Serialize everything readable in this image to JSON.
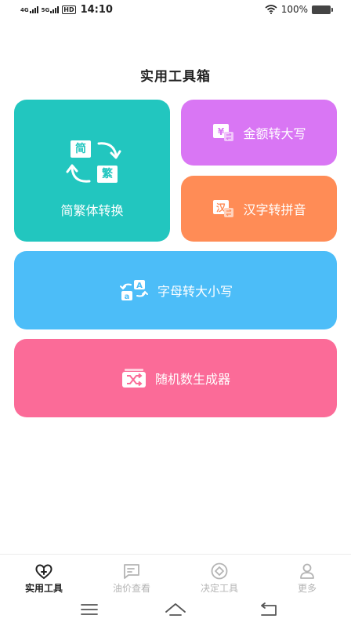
{
  "status_bar": {
    "network_1": "4G",
    "network_2": "5G",
    "hd": "HD",
    "time": "14:10",
    "battery": "100%"
  },
  "page": {
    "title": "实用工具箱"
  },
  "cards": {
    "jianfan": {
      "label": "简繁体转换",
      "icon_jian": "简",
      "icon_fan": "繁",
      "color": "#22c6bf"
    },
    "jine": {
      "label": "金额转大写",
      "icon": "yen-convert-icon",
      "color": "#d976f4"
    },
    "pinyin": {
      "label": "汉字转拼音",
      "icon": "han-convert-icon",
      "icon_char": "汉",
      "color": "#ff8c56"
    },
    "daxiaoxie": {
      "label": "字母转大小写",
      "icon": "letter-case-icon",
      "color": "#4cbdf8"
    },
    "random": {
      "label": "随机数生成器",
      "icon": "shuffle-icon",
      "color": "#fb6b98"
    }
  },
  "bottom_nav": {
    "items": [
      {
        "label": "实用工具",
        "icon": "toolbox-heart-icon",
        "active": true
      },
      {
        "label": "油价查看",
        "icon": "chat-box-icon",
        "active": false
      },
      {
        "label": "决定工具",
        "icon": "decision-circle-icon",
        "active": false
      },
      {
        "label": "更多",
        "icon": "person-icon",
        "active": false
      }
    ]
  },
  "system_nav": [
    "menu-icon",
    "home-icon",
    "back-icon"
  ]
}
